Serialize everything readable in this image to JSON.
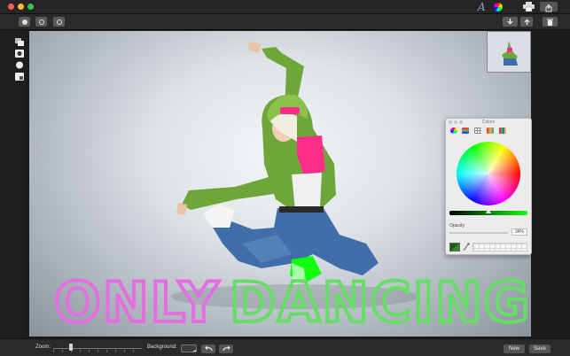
{
  "titlebar": {
    "font_icon": "A",
    "icons": [
      "font-icon",
      "color-wheel-icon",
      "printer-icon",
      "share-icon"
    ]
  },
  "toolbar": {
    "left_icons": [
      "options-icon",
      "history-icon",
      "adjust-icon"
    ],
    "right_icons": [
      "download-icon",
      "upload-icon",
      "trash-icon"
    ]
  },
  "tools": [
    "layers-icon",
    "mask-icon",
    "brush-icon",
    "crop-icon"
  ],
  "canvas": {
    "overlay_text": {
      "word1": "ONLY",
      "word2": "DANCING",
      "word1_color": "#e26fe0",
      "word2_color": "#66dd66"
    }
  },
  "colors_panel": {
    "title": "Colors",
    "opacity_label": "Opacity",
    "opacity_value": "34%",
    "brightness_fraction": 0.5,
    "opacity_fraction": 0.34,
    "tabs": [
      "color-wheel-tab",
      "sliders-tab",
      "palettes-tab",
      "image-palette-tab",
      "crayons-tab"
    ]
  },
  "bottom": {
    "zoom_label": "Zoom:",
    "zoom_fraction": 0.2,
    "background_label": "Background:",
    "new_label": "New",
    "save_label": "Save"
  },
  "colors": {
    "accent_green": "#10ff10",
    "shirt_pink": "#ff2d8a",
    "jacket_green": "#6fa63a",
    "jeans_blue": "#3f6ea8"
  }
}
